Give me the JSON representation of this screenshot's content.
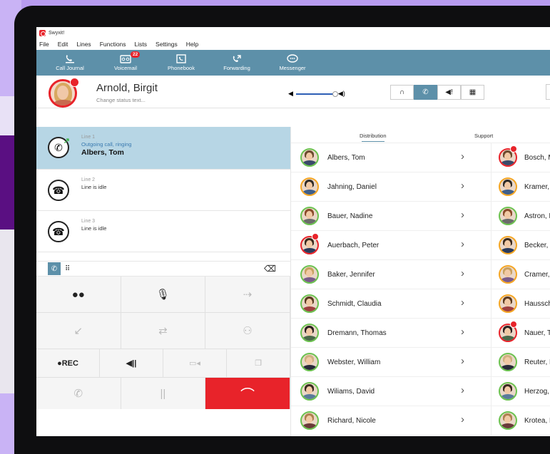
{
  "app": {
    "title": "Swyxit!"
  },
  "menu": [
    "File",
    "Edit",
    "Lines",
    "Functions",
    "Lists",
    "Settings",
    "Help"
  ],
  "toolbar": [
    {
      "label": "Call Journal",
      "icon": "call-journal-icon"
    },
    {
      "label": "Voicemail",
      "icon": "voicemail-icon",
      "badge": "22"
    },
    {
      "label": "Phonebook",
      "icon": "phonebook-icon"
    },
    {
      "label": "Forwarding",
      "icon": "forwarding-icon"
    },
    {
      "label": "Messenger",
      "icon": "messenger-icon"
    }
  ],
  "user": {
    "name": "Arnold, Birgit",
    "status_placeholder": "Change status text..."
  },
  "lines": [
    {
      "number": "Line 1",
      "status": "Outgoing call, ringing",
      "contact": "Albers, Tom",
      "active": true
    },
    {
      "number": "Line 2",
      "status": "Line is idle",
      "contact": ""
    },
    {
      "number": "Line 3",
      "status": "Line is idle",
      "contact": ""
    }
  ],
  "dial": {
    "rec_label": "●REC"
  },
  "tabs": {
    "distribution": "Distribution",
    "support": "Support"
  },
  "contacts_distribution": [
    {
      "name": "Albers, Tom",
      "status": "green",
      "calling": false
    },
    {
      "name": "Jahning, Daniel",
      "status": "orange",
      "calling": false
    },
    {
      "name": "Bauer, Nadine",
      "status": "green",
      "calling": false
    },
    {
      "name": "Auerbach, Peter",
      "status": "red",
      "calling": true
    },
    {
      "name": "Baker, Jennifer",
      "status": "green",
      "calling": false
    },
    {
      "name": "Schmidt, Claudia",
      "status": "green",
      "calling": false
    },
    {
      "name": "Dremann, Thomas",
      "status": "green",
      "calling": false
    },
    {
      "name": "Webster, William",
      "status": "green",
      "calling": false
    },
    {
      "name": "Wiliams, David",
      "status": "green",
      "calling": false
    },
    {
      "name": "Richard, Nicole",
      "status": "green",
      "calling": false
    }
  ],
  "contacts_support": [
    {
      "name": "Bosch, M",
      "status": "red",
      "calling": true
    },
    {
      "name": "Kramer, F",
      "status": "orange",
      "calling": false
    },
    {
      "name": "Astron, K",
      "status": "green",
      "calling": false
    },
    {
      "name": "Becker, T",
      "status": "orange",
      "calling": false
    },
    {
      "name": "Cramer, A",
      "status": "orange",
      "calling": false
    },
    {
      "name": "Hausschi",
      "status": "orange",
      "calling": false
    },
    {
      "name": "Nauer, Ti",
      "status": "red",
      "calling": true
    },
    {
      "name": "Reuter, L",
      "status": "green",
      "calling": false
    },
    {
      "name": "Herzog, S",
      "status": "green",
      "calling": false
    },
    {
      "name": "Krotea, K",
      "status": "green",
      "calling": false
    }
  ],
  "colors": {
    "accent": "#5d90a9",
    "hangup": "#e8232a",
    "line_active": "#b7d6e5"
  }
}
